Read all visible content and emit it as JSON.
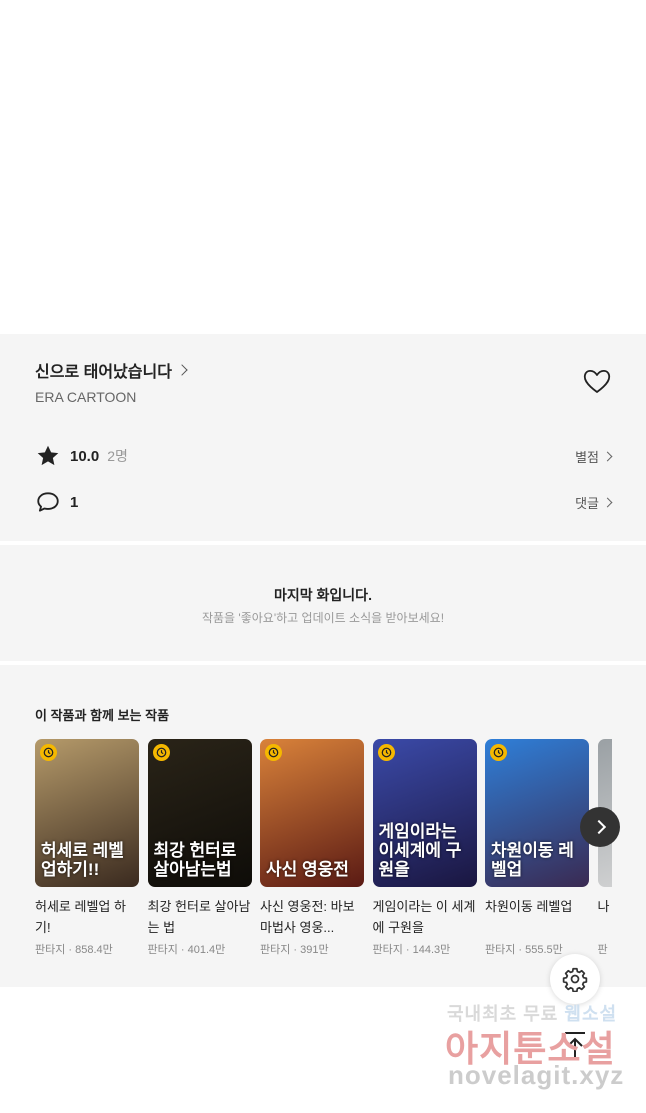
{
  "work": {
    "title": "신으로 태어났습니다",
    "author": "ERA CARTOON",
    "rating": "10.0",
    "rating_count": "2명",
    "rate_label": "별점",
    "comments": "1",
    "comment_label": "댓글"
  },
  "last_episode": {
    "title": "마지막 화입니다.",
    "subtitle": "작품을 '좋아요'하고 업데이트 소식을 받아보세요!"
  },
  "recommend": {
    "heading": "이 작품과 함께 보는 작품",
    "items": [
      {
        "title": "허세로 레벨업 하기!",
        "meta": "판타지 · 858.4만",
        "cover_text": "허세로 레벨 업하기!!",
        "colors": [
          "#b59a6a",
          "#3a2a1f"
        ]
      },
      {
        "title": "최강 헌터로 살아남는 법",
        "meta": "판타지 · 401.4만",
        "cover_text": "최강 헌터로 살아남는법",
        "colors": [
          "#2a2418",
          "#0e0c08"
        ]
      },
      {
        "title": "사신 영웅전: 바보 마법사 영웅...",
        "meta": "판타지 · 391만",
        "cover_text": "사신 영웅전",
        "colors": [
          "#d9823a",
          "#5a1a14"
        ]
      },
      {
        "title": "게임이라는 이 세계에 구원을",
        "meta": "판타지 · 144.3만",
        "cover_text": "게임이라는 이세계에 구원을",
        "colors": [
          "#3b4aa8",
          "#1a1640"
        ]
      },
      {
        "title": "차원이동 레벨업",
        "meta": "판타지 · 555.5만",
        "cover_text": "차원이동 레벨업",
        "colors": [
          "#2f7fd8",
          "#3a2a52"
        ]
      },
      {
        "title": "나 레",
        "meta": "판",
        "cover_text": "",
        "colors": [
          "#9aa0a4",
          "#dadada"
        ]
      }
    ]
  },
  "watermark": {
    "line1_a": "국내최초 무료",
    "line1_b": "웹소설",
    "line2": "아지툰소설",
    "line3": "novelagit.xyz"
  }
}
